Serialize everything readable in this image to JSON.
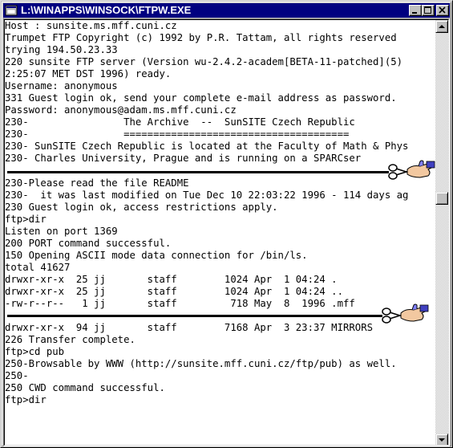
{
  "window": {
    "title": "L:\\WINAPPS\\WINSOCK\\FTPW.EXE"
  },
  "terminal": {
    "block1": [
      "Host : sunsite.ms.mff.cuni.cz",
      "Trumpet FTP Copyright (c) 1992 by P.R. Tattam, all rights reserved",
      "trying 194.50.23.33",
      "220 sunsite FTP server (Version wu-2.4.2-academ[BETA-11-patched](5)",
      "2:25:07 MET DST 1996) ready.",
      "Username: anonymous",
      "331 Guest login ok, send your complete e-mail address as password.",
      "Password: anonymous@adam.ms.mff.cuni.cz",
      "230-                The Archive  --  SunSITE Czech Republic",
      "230-                ======================================",
      "230- SunSITE Czech Republic is located at the Faculty of Math & Phys",
      "230- Charles University, Prague and is running on a SPARCser"
    ],
    "block2": [
      "230-Please read the file README",
      "230-  it was last modified on Tue Dec 10 22:03:22 1996 - 114 days ag",
      "230 Guest login ok, access restrictions apply.",
      "ftp>dir",
      "Listen on port 1369",
      "200 PORT command successful.",
      "150 Opening ASCII mode data connection for /bin/ls.",
      "total 41627",
      "drwxr-xr-x  25 jj       staff        1024 Apr  1 04:24 .",
      "drwxr-xr-x  25 jj       staff        1024 Apr  1 04:24 ..",
      "-rw-r--r--   1 jj       staff         718 May  8  1996 .mff"
    ],
    "block3": [
      "drwxr-xr-x  94 jj       staff        7168 Apr  3 23:37 MIRRORS",
      "226 Transfer complete.",
      "ftp>cd pub",
      "250-Browsable by WWW (http://sunsite.mff.cuni.cz/ftp/pub) as well.",
      "250-",
      "250 CWD command successful.",
      "ftp>dir"
    ]
  }
}
